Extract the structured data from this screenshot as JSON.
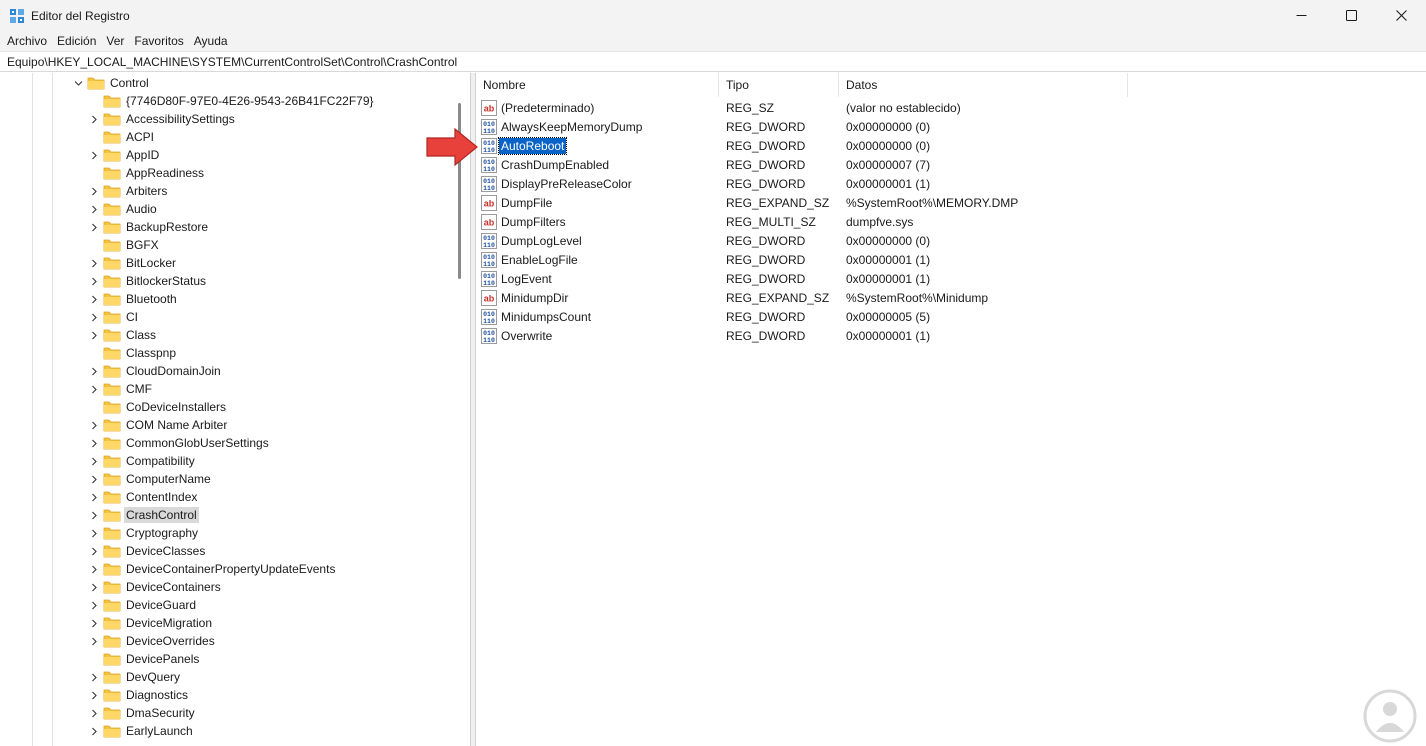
{
  "window": {
    "title": "Editor del Registro",
    "controls": [
      "minimize-icon",
      "maximize-icon",
      "close-icon"
    ]
  },
  "menu": [
    {
      "label": "Archivo"
    },
    {
      "label": "Edición"
    },
    {
      "label": "Ver"
    },
    {
      "label": "Favoritos"
    },
    {
      "label": "Ayuda"
    }
  ],
  "address": "Equipo\\HKEY_LOCAL_MACHINE\\SYSTEM\\CurrentControlSet\\Control\\CrashControl",
  "tree": {
    "parent": "Control",
    "items": [
      {
        "label": "{7746D80F-97E0-4E26-9543-26B41FC22F79}",
        "expandable": false
      },
      {
        "label": "AccessibilitySettings",
        "expandable": true
      },
      {
        "label": "ACPI",
        "expandable": false
      },
      {
        "label": "AppID",
        "expandable": true
      },
      {
        "label": "AppReadiness",
        "expandable": false
      },
      {
        "label": "Arbiters",
        "expandable": true
      },
      {
        "label": "Audio",
        "expandable": true
      },
      {
        "label": "BackupRestore",
        "expandable": true
      },
      {
        "label": "BGFX",
        "expandable": false
      },
      {
        "label": "BitLocker",
        "expandable": true
      },
      {
        "label": "BitlockerStatus",
        "expandable": true
      },
      {
        "label": "Bluetooth",
        "expandable": true
      },
      {
        "label": "CI",
        "expandable": true
      },
      {
        "label": "Class",
        "expandable": true
      },
      {
        "label": "Classpnp",
        "expandable": false
      },
      {
        "label": "CloudDomainJoin",
        "expandable": true
      },
      {
        "label": "CMF",
        "expandable": true
      },
      {
        "label": "CoDeviceInstallers",
        "expandable": false
      },
      {
        "label": "COM Name Arbiter",
        "expandable": true
      },
      {
        "label": "CommonGlobUserSettings",
        "expandable": true
      },
      {
        "label": "Compatibility",
        "expandable": true
      },
      {
        "label": "ComputerName",
        "expandable": true
      },
      {
        "label": "ContentIndex",
        "expandable": true
      },
      {
        "label": "CrashControl",
        "expandable": true,
        "selected": true
      },
      {
        "label": "Cryptography",
        "expandable": true
      },
      {
        "label": "DeviceClasses",
        "expandable": true
      },
      {
        "label": "DeviceContainerPropertyUpdateEvents",
        "expandable": true
      },
      {
        "label": "DeviceContainers",
        "expandable": true
      },
      {
        "label": "DeviceGuard",
        "expandable": true
      },
      {
        "label": "DeviceMigration",
        "expandable": true
      },
      {
        "label": "DeviceOverrides",
        "expandable": true
      },
      {
        "label": "DevicePanels",
        "expandable": false
      },
      {
        "label": "DevQuery",
        "expandable": true
      },
      {
        "label": "Diagnostics",
        "expandable": true
      },
      {
        "label": "DmaSecurity",
        "expandable": true
      },
      {
        "label": "EarlyLaunch",
        "expandable": true
      }
    ]
  },
  "list": {
    "columns": {
      "name": "Nombre",
      "type": "Tipo",
      "data": "Datos"
    },
    "rows": [
      {
        "name": "(Predeterminado)",
        "type": "REG_SZ",
        "data": "(valor no establecido)",
        "icon": "string-value-icon"
      },
      {
        "name": "AlwaysKeepMemoryDump",
        "type": "REG_DWORD",
        "data": "0x00000000 (0)",
        "icon": "binary-value-icon"
      },
      {
        "name": "AutoReboot",
        "type": "REG_DWORD",
        "data": "0x00000000 (0)",
        "icon": "binary-value-icon",
        "selected": true
      },
      {
        "name": "CrashDumpEnabled",
        "type": "REG_DWORD",
        "data": "0x00000007 (7)",
        "icon": "binary-value-icon"
      },
      {
        "name": "DisplayPreReleaseColor",
        "type": "REG_DWORD",
        "data": "0x00000001 (1)",
        "icon": "binary-value-icon"
      },
      {
        "name": "DumpFile",
        "type": "REG_EXPAND_SZ",
        "data": "%SystemRoot%\\MEMORY.DMP",
        "icon": "string-value-icon"
      },
      {
        "name": "DumpFilters",
        "type": "REG_MULTI_SZ",
        "data": "dumpfve.sys",
        "icon": "string-value-icon"
      },
      {
        "name": "DumpLogLevel",
        "type": "REG_DWORD",
        "data": "0x00000000 (0)",
        "icon": "binary-value-icon"
      },
      {
        "name": "EnableLogFile",
        "type": "REG_DWORD",
        "data": "0x00000001 (1)",
        "icon": "binary-value-icon"
      },
      {
        "name": "LogEvent",
        "type": "REG_DWORD",
        "data": "0x00000001 (1)",
        "icon": "binary-value-icon"
      },
      {
        "name": "MinidumpDir",
        "type": "REG_EXPAND_SZ",
        "data": "%SystemRoot%\\Minidump",
        "icon": "string-value-icon"
      },
      {
        "name": "MinidumpsCount",
        "type": "REG_DWORD",
        "data": "0x00000005 (5)",
        "icon": "binary-value-icon"
      },
      {
        "name": "Overwrite",
        "type": "REG_DWORD",
        "data": "0x00000001 (1)",
        "icon": "binary-value-icon"
      }
    ]
  },
  "colors": {
    "selection": "#0a64c8",
    "tree_selection": "#d9d9d9",
    "arrow": "#e8413b",
    "folder": "#f5c342"
  }
}
